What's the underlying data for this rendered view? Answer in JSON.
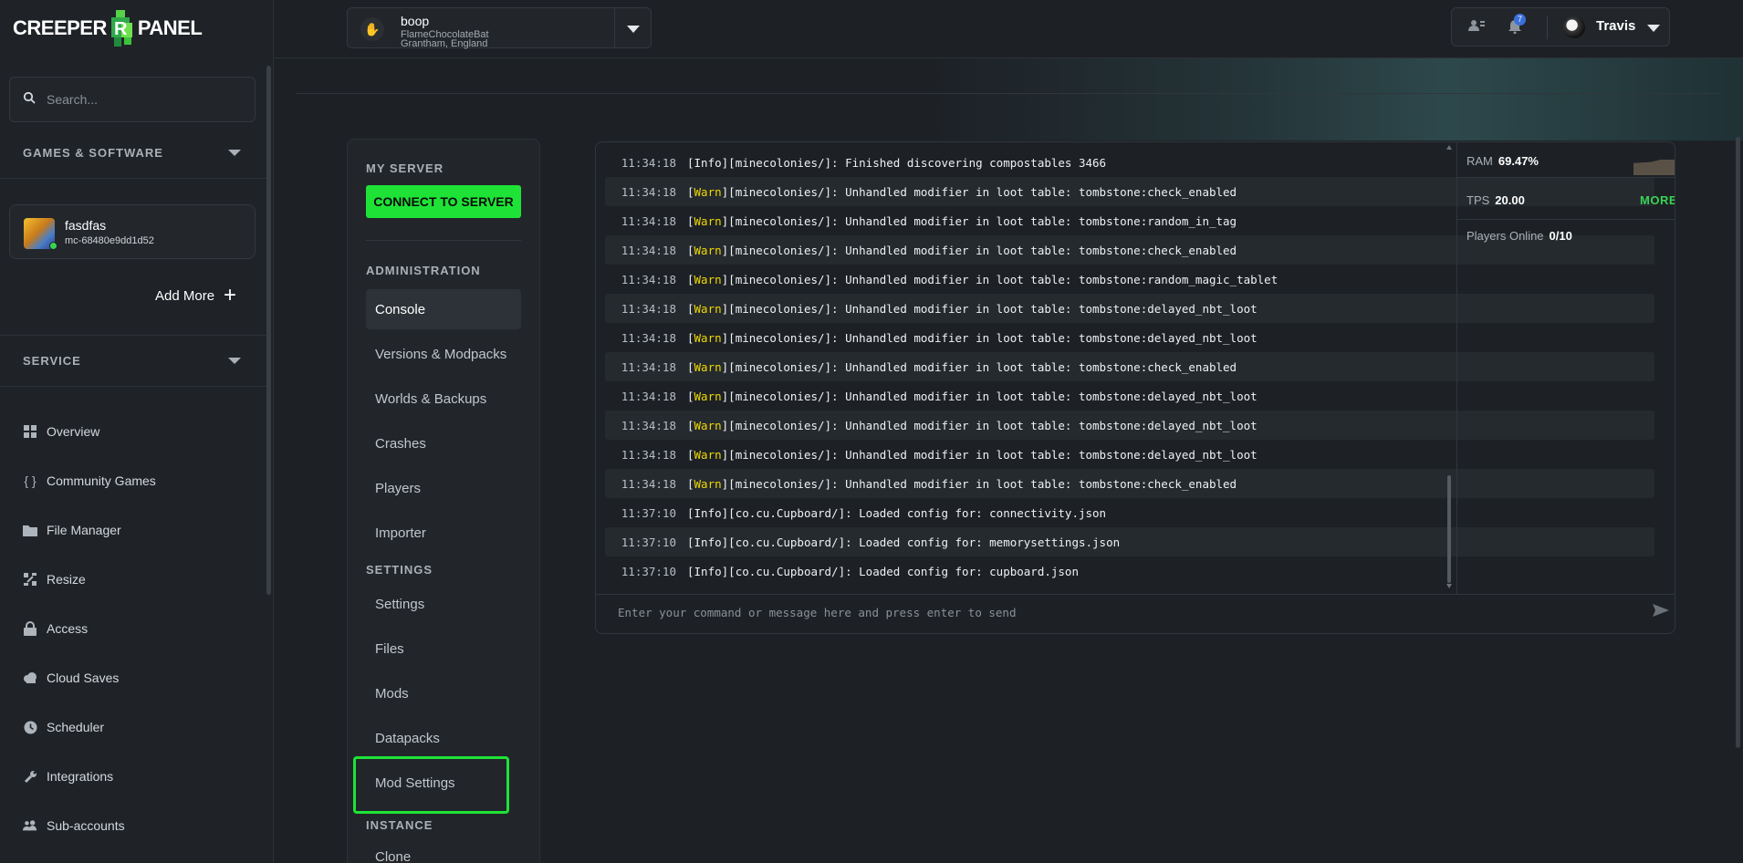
{
  "brand": {
    "name_left": "CREEPER",
    "name_right": "PANEL"
  },
  "sidebar": {
    "search_placeholder": "Search...",
    "section_games": "GAMES & SOFTWARE",
    "server_card": {
      "name": "fasdfas",
      "id": "mc-68480e9dd1d52"
    },
    "add_more": "Add More",
    "section_service": "SERVICE",
    "nav": [
      {
        "label": "Overview",
        "icon": "grid-icon"
      },
      {
        "label": "Community Games",
        "icon": "braces-icon"
      },
      {
        "label": "File Manager",
        "icon": "folder-icon"
      },
      {
        "label": "Resize",
        "icon": "resize-icon"
      },
      {
        "label": "Access",
        "icon": "lock-icon"
      },
      {
        "label": "Cloud Saves",
        "icon": "cloud-icon"
      },
      {
        "label": "Scheduler",
        "icon": "clock-icon"
      },
      {
        "label": "Integrations",
        "icon": "wrench-icon"
      },
      {
        "label": "Sub-accounts",
        "icon": "users-icon"
      }
    ]
  },
  "topbar": {
    "server": {
      "name": "boop",
      "line1": "FlameChocolateBat",
      "line2": "Grantham, England"
    },
    "notifications_count": "7",
    "user": "Travis"
  },
  "subnav": {
    "my_server": "MY SERVER",
    "connect": "CONNECT TO SERVER",
    "administration": "ADMINISTRATION",
    "admin_items": [
      "Console",
      "Versions & Modpacks",
      "Worlds & Backups",
      "Crashes",
      "Players",
      "Importer"
    ],
    "settings": "SETTINGS",
    "settings_items": [
      "Settings",
      "Files",
      "Mods",
      "Datapacks",
      "Mod Settings"
    ],
    "instance": "INSTANCE",
    "instance_items": [
      "Clone"
    ]
  },
  "console": {
    "lines": [
      {
        "time": "11:34:18",
        "level": "Info",
        "text": "[minecolonies/]: Finished discovering compostables 3466"
      },
      {
        "time": "11:34:18",
        "level": "Warn",
        "text": "[minecolonies/]: Unhandled modifier in loot table: tombstone:check_enabled"
      },
      {
        "time": "11:34:18",
        "level": "Warn",
        "text": "[minecolonies/]: Unhandled modifier in loot table: tombstone:random_in_tag"
      },
      {
        "time": "11:34:18",
        "level": "Warn",
        "text": "[minecolonies/]: Unhandled modifier in loot table: tombstone:check_enabled"
      },
      {
        "time": "11:34:18",
        "level": "Warn",
        "text": "[minecolonies/]: Unhandled modifier in loot table: tombstone:random_magic_tablet"
      },
      {
        "time": "11:34:18",
        "level": "Warn",
        "text": "[minecolonies/]: Unhandled modifier in loot table: tombstone:delayed_nbt_loot"
      },
      {
        "time": "11:34:18",
        "level": "Warn",
        "text": "[minecolonies/]: Unhandled modifier in loot table: tombstone:delayed_nbt_loot"
      },
      {
        "time": "11:34:18",
        "level": "Warn",
        "text": "[minecolonies/]: Unhandled modifier in loot table: tombstone:check_enabled"
      },
      {
        "time": "11:34:18",
        "level": "Warn",
        "text": "[minecolonies/]: Unhandled modifier in loot table: tombstone:delayed_nbt_loot"
      },
      {
        "time": "11:34:18",
        "level": "Warn",
        "text": "[minecolonies/]: Unhandled modifier in loot table: tombstone:delayed_nbt_loot"
      },
      {
        "time": "11:34:18",
        "level": "Warn",
        "text": "[minecolonies/]: Unhandled modifier in loot table: tombstone:delayed_nbt_loot"
      },
      {
        "time": "11:34:18",
        "level": "Warn",
        "text": "[minecolonies/]: Unhandled modifier in loot table: tombstone:check_enabled"
      },
      {
        "time": "11:37:10",
        "level": "Info",
        "text": "[co.cu.Cupboard/]: Loaded config for: connectivity.json"
      },
      {
        "time": "11:37:10",
        "level": "Info",
        "text": "[co.cu.Cupboard/]: Loaded config for: memorysettings.json"
      },
      {
        "time": "11:37:10",
        "level": "Info",
        "text": "[co.cu.Cupboard/]: Loaded config for: cupboard.json"
      }
    ],
    "command_placeholder": "Enter your command or message here and press enter to send"
  },
  "stats": {
    "ram_label": "RAM",
    "ram_value": "69.47%",
    "tps_label": "TPS",
    "tps_value": "20.00",
    "more": "MORE",
    "players_label": "Players Online",
    "players_value": "0/10"
  },
  "colors": {
    "accent_green": "#1ee336",
    "warn_yellow": "#f0d800",
    "notification_blue": "#3b6fd9"
  }
}
